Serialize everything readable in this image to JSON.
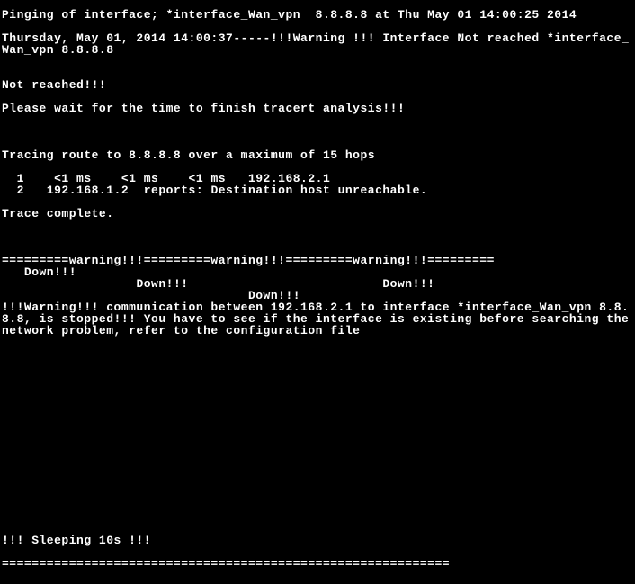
{
  "header": {
    "ping_line": "Pinging of interface; *interface_Wan_vpn  8.8.8.8 at Thu May 01 14:00:25 2014",
    "warning_line": "Thursday, May 01, 2014 14:00:37-----!!!Warning !!! Interface Not reached *interface_Wan_vpn 8.8.8.8"
  },
  "status": {
    "not_reached": "Not reached!!!",
    "please_wait": "Please wait for the time to finish tracert analysis!!!"
  },
  "trace": {
    "heading": "Tracing route to 8.8.8.8 over a maximum of 15 hops",
    "hop1": "  1    <1 ms    <1 ms    <1 ms   192.168.2.1",
    "hop2": "  2   192.168.1.2  reports: Destination host unreachable.",
    "complete": "Trace complete."
  },
  "warnbar": {
    "line1": "=========warning!!!=========warning!!!=========warning!!!=========",
    "line2": "   Down!!!                                        ",
    "line3": "                  Down!!!                          Down!!!",
    "line4": "                                 Down!!!",
    "msg": "!!!Warning!!! communication between 192.168.2.1 to interface *interface_Wan_vpn 8.8.8.8, is stopped!!! You have to see if the interface is existing before searching the network problem, refer to the configuration file"
  },
  "footer": {
    "sleep": "!!! Sleeping 10s !!!",
    "divider": "============================================================"
  }
}
